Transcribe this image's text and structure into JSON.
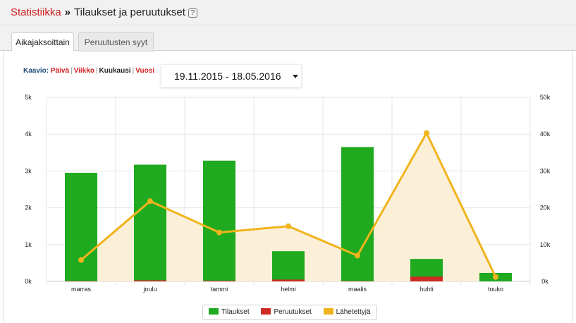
{
  "header": {
    "breadcrumb_link": "Statistiikka",
    "separator": "»",
    "title": "Tilaukset ja peruutukset",
    "help": "?"
  },
  "tabs": [
    {
      "label": "Aikajaksoittain",
      "active": true
    },
    {
      "label": "Peruutusten syyt",
      "active": false
    }
  ],
  "controls": {
    "label": "Kaavio:",
    "periods": [
      "Päivä",
      "Viikko",
      "Kuukausi",
      "Vuosi"
    ],
    "selected_period": "Kuukausi",
    "separator": "|",
    "date_range": "19.11.2015 - 18.05.2016"
  },
  "colors": {
    "tilaukset": "#1faa1f",
    "peruutukset": "#cc2a22",
    "lahetetyt": "#f0b41c",
    "area_fill": "#fbefd8"
  },
  "chart_data": {
    "type": "bar",
    "categories": [
      "marras",
      "joulu",
      "tammi",
      "helmi",
      "maalis",
      "huhti",
      "touko"
    ],
    "series": [
      {
        "name": "Tilaukset",
        "type": "bar",
        "axis": "left",
        "values": [
          2950,
          3170,
          3280,
          820,
          3650,
          610,
          230
        ]
      },
      {
        "name": "Peruutukset",
        "type": "bar",
        "axis": "left",
        "values": [
          10,
          30,
          20,
          50,
          10,
          130,
          0
        ]
      },
      {
        "name": "Lähetettyjä",
        "type": "area-line",
        "axis": "right",
        "values": [
          5800,
          21800,
          13300,
          15000,
          7000,
          40300,
          1200
        ]
      }
    ],
    "y_left": {
      "ylim": [
        0,
        5000
      ],
      "ticks": [
        "0k",
        "1k",
        "2k",
        "3k",
        "4k",
        "5k"
      ]
    },
    "y_right": {
      "ylim": [
        0,
        50000
      ],
      "ticks": [
        "0k",
        "10k",
        "20k",
        "30k",
        "40k",
        "50k"
      ]
    },
    "grid": true,
    "legend": "bottom-center"
  }
}
